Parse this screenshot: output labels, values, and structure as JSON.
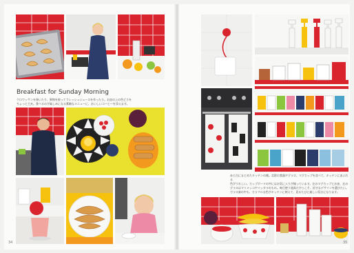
{
  "left_page": {
    "heading": "Breakfast for Sunday Morning",
    "caption_lines": [
      "クロワッサンを焼いたり、果物を絞ってフレッシュジュースを作ったり。お皿の上の色どりを",
      "ちょっと工夫。食べるのが楽しみになる素敵なメニューに、おいしいコーヒーを添えます。"
    ],
    "page_number": "34"
  },
  "right_page": {
    "caption_lines": [
      "赤と白にまとめたキッチンの棚。北欧の食器やグラス、マグカップを並べて、キッチンにあふれる",
      "色がうれしい。カップボードの中にはお気に入りが揃っています。左のマグカップとお皿、右の",
      "グラスはマリメッコやイッタラのもの。毎日使う道具だからこそ、好きなデザインを選びたい。",
      "ガラス扉の中も、カラフルな色がキッチンに映えて、見るたびに楽しい気分になります。"
    ],
    "page_number": "35"
  },
  "colors": {
    "accent_red": "#d9232d",
    "yellow": "#f6c20e",
    "orange": "#f39a1e"
  }
}
